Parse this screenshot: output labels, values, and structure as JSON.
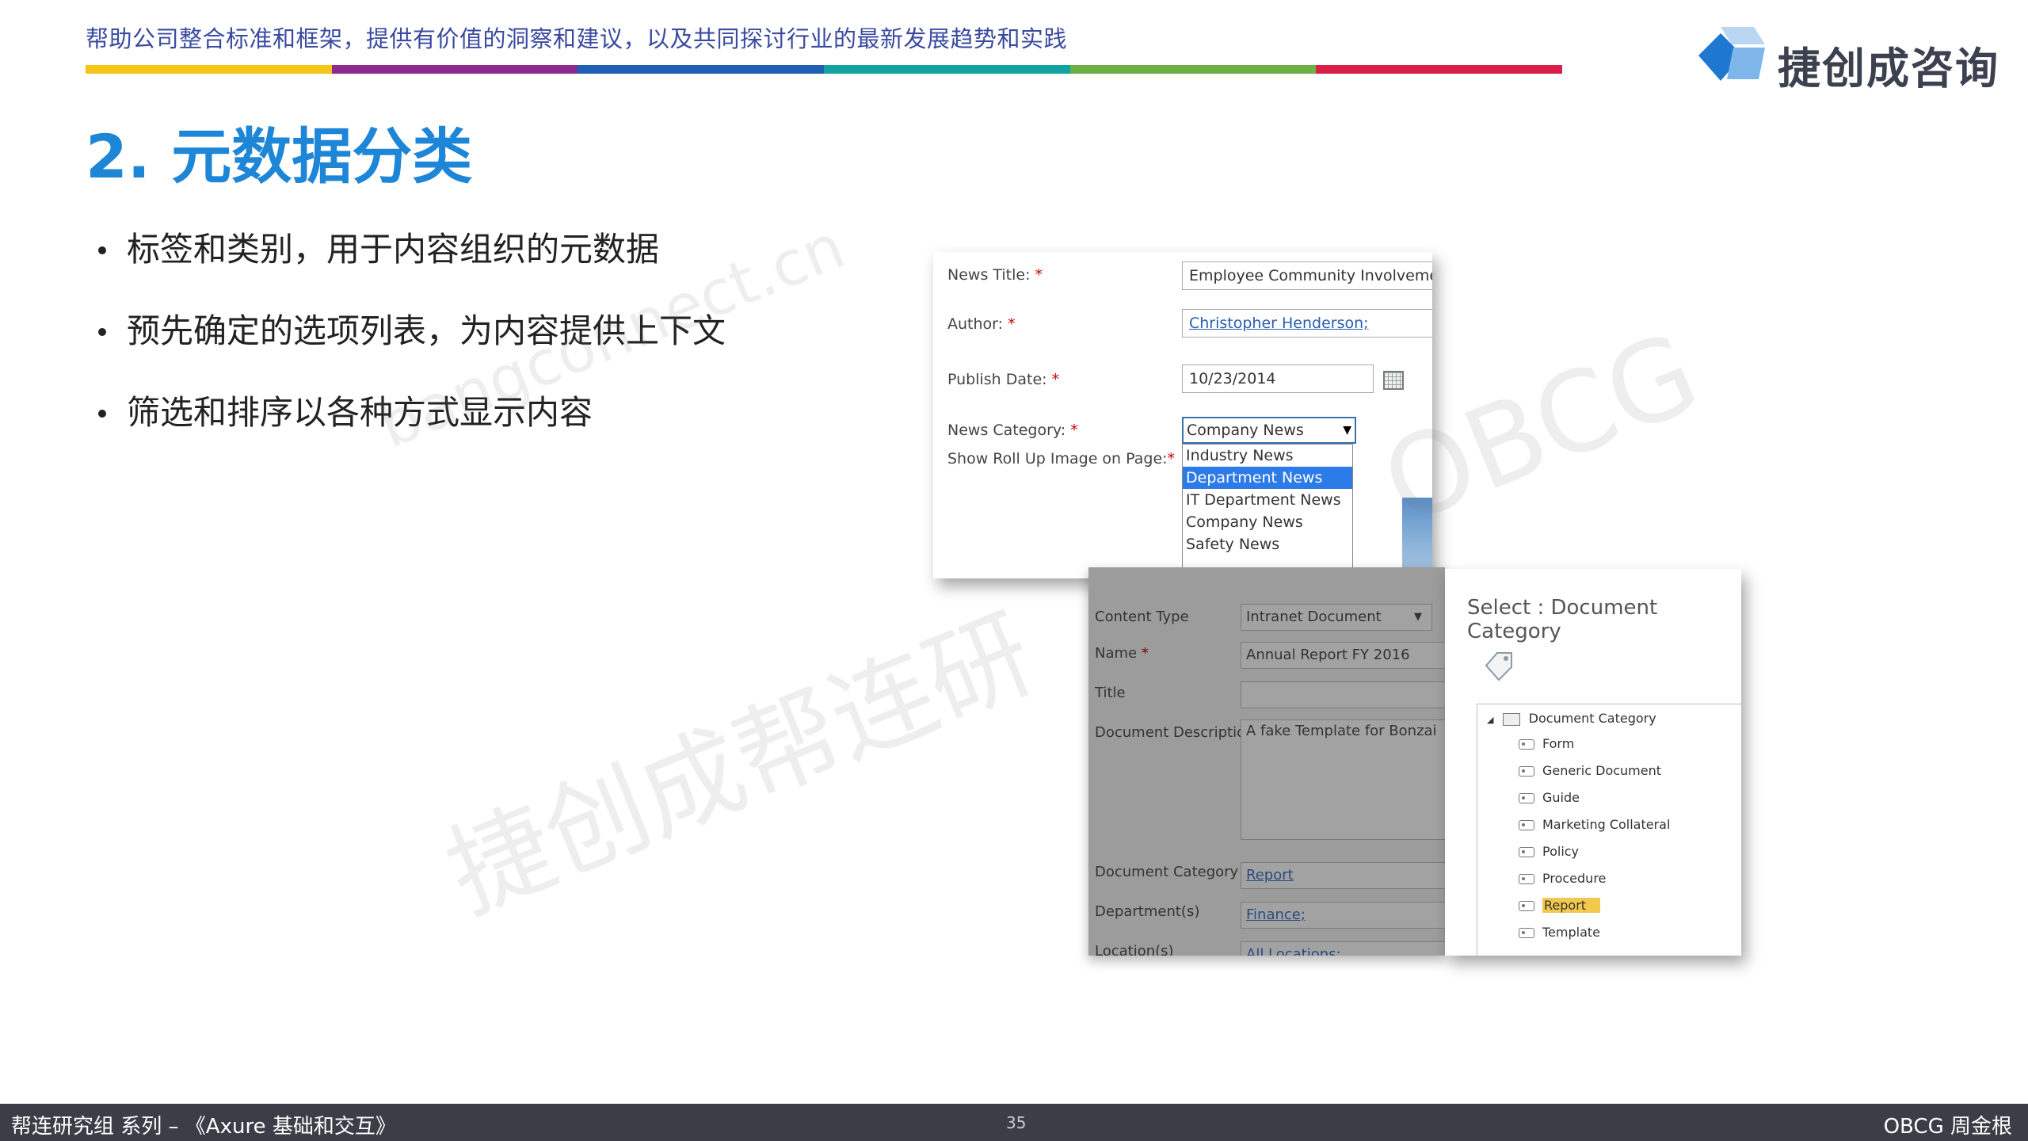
{
  "header": {
    "tagline": "帮助公司整合标准和框架，提供有价值的洞察和建议，以及共同探讨行业的最新发展趋势和实践",
    "colorbar": [
      "#f5c518",
      "#8e2a8e",
      "#1f5fb4",
      "#12a3a0",
      "#6ab043",
      "#d81f4a"
    ],
    "logo_text": "捷创成咨询",
    "logo_colors": [
      "#1e78d2",
      "#7fb6ea",
      "#b9d7f2"
    ]
  },
  "slide": {
    "title": "2. 元数据分类",
    "bullets": [
      "标签和类别，用于内容组织的元数据",
      "预先确定的选项列表，为内容提供上下文",
      "筛选和排序以各种方式显示内容"
    ]
  },
  "watermarks": [
    "bangconnect.cn",
    "捷创成帮连研",
    "OBCG"
  ],
  "form1": {
    "news_title_label": "News Title:",
    "news_title_value": "Employee Community Involvement",
    "author_label": "Author:",
    "author_value": "Christopher Henderson;",
    "publish_date_label": "Publish Date:",
    "publish_date_value": "10/23/2014",
    "news_category_label": "News Category:",
    "news_category_value": "Company News",
    "roll_up_label": "Show Roll Up Image on Page:",
    "required_mark": "*",
    "dropdown_options": [
      "Industry News",
      "Department News",
      "IT Department News",
      "Company News",
      "Safety News"
    ],
    "dropdown_selected_index": 1
  },
  "form2": {
    "content_type_label": "Content Type",
    "content_type_value": "Intranet Document",
    "name_label": "Name",
    "name_value": "Annual Report FY 2016",
    "title_label": "Title",
    "title_value": "",
    "description_label": "Document Description",
    "description_value": "A fake Template for Bonzai",
    "category_label": "Document Category",
    "category_value": "Report",
    "departments_label": "Department(s)",
    "departments_value": "Finance;",
    "locations_label": "Location(s)",
    "locations_value": "All Locations;"
  },
  "picker": {
    "title": "Select : Document Category",
    "root": "Document Category",
    "items": [
      "Form",
      "Generic Document",
      "Guide",
      "Marketing Collateral",
      "Policy",
      "Procedure",
      "Report",
      "Template"
    ],
    "highlighted_index": 6
  },
  "footer": {
    "left": "帮连研究组 系列 – 《Axure 基础和交互》",
    "page": "35",
    "right": "OBCG 周金根"
  }
}
